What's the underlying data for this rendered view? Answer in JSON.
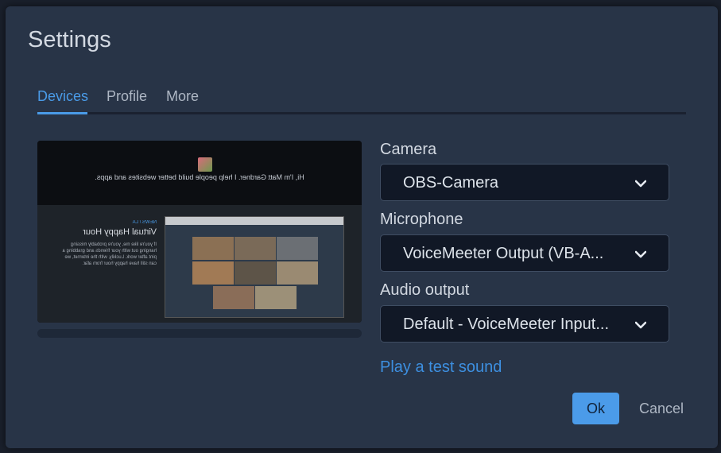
{
  "dialog": {
    "title": "Settings"
  },
  "tabs": [
    {
      "label": "Devices",
      "active": true
    },
    {
      "label": "Profile",
      "active": false
    },
    {
      "label": "More",
      "active": false
    }
  ],
  "preview": {
    "overlay_text": "Hi, I'm Matt Gardner. I help people build better websites and apps.",
    "side_tag": "NEWS / LA",
    "side_heading": "Virtual Happy Hour",
    "side_body": "If you're like me, you're probably missing hanging out with your friends and grabbing a pint after work. Luckily, with the internet, we can still have happy hour from afar."
  },
  "devices": {
    "camera": {
      "label": "Camera",
      "value": "OBS-Camera"
    },
    "microphone": {
      "label": "Microphone",
      "value": "VoiceMeeter Output (VB-A..."
    },
    "audio_output": {
      "label": "Audio output",
      "value": "Default - VoiceMeeter Input..."
    },
    "test_sound_label": "Play a test sound"
  },
  "buttons": {
    "ok_label": "Ok",
    "cancel_label": "Cancel"
  },
  "colors": {
    "accent": "#4a9be8",
    "dialog_bg": "#283447",
    "select_bg": "#111826"
  }
}
